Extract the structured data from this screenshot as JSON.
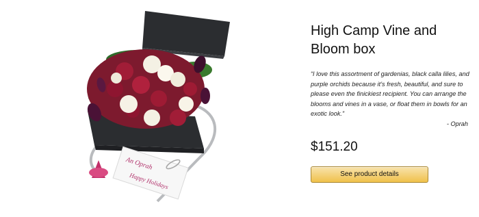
{
  "product": {
    "title": "High Camp Vine and Bloom box",
    "quote": "“I love this assortment of gardenias, black calla lilies, and purple orchids because it’s fresh, beautiful, and sure to please even the finickiest recipient. You can arrange the blooms and vines in a vase, or float them in bowls for an exotic look.”",
    "attribution": "- Oprah",
    "price": "$151.20",
    "button_label": "See product details",
    "card_text": {
      "line1": "An Oprah",
      "line2": "Happy Holidays"
    }
  },
  "colors": {
    "button_top": "#f8e3ad",
    "button_bottom": "#f0c14b",
    "button_border": "#a88734",
    "box": "#2b2d30",
    "ribbon": "#b9bbbe",
    "bloom_red": "#9e1b34",
    "bloom_white": "#f4f1e4",
    "bloom_purple": "#4a1236"
  },
  "icons": {
    "card_clip": "paperclip-icon"
  }
}
